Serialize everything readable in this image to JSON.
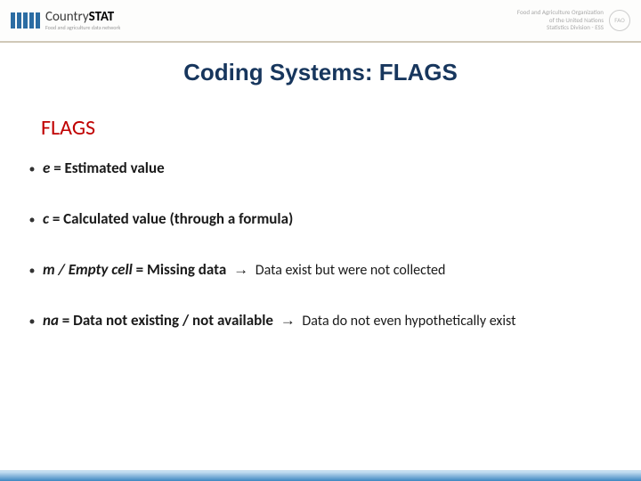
{
  "header": {
    "logo_main_plain": "Country",
    "logo_main_bold": "STAT",
    "logo_sub": "Food and agriculture data network",
    "fao_line1": "Food and Agriculture Organization",
    "fao_line2": "of the United Nations",
    "fao_line3": "Statistics Division - ESS",
    "fao_badge": "FAO"
  },
  "title": "Coding Systems: FLAGS",
  "section": "FLAGS",
  "bullets": [
    {
      "codeItalic": "e",
      "eq": " = ",
      "label": "Estimated value",
      "arrow": "",
      "expl": ""
    },
    {
      "codeItalic": "c",
      "eq": " = ",
      "label": "Calculated value (through a formula)",
      "arrow": "",
      "expl": ""
    },
    {
      "codeItalic": "m / Empty cell",
      "eq": " = ",
      "label": "Missing data ",
      "arrow": "→",
      "expl": "  Data exist but were not collected"
    },
    {
      "codeItalic": "na",
      "eq": " = ",
      "label": "Data not existing / not available ",
      "arrow": "→",
      "expl": "  Data do not even hypothetically exist"
    }
  ]
}
